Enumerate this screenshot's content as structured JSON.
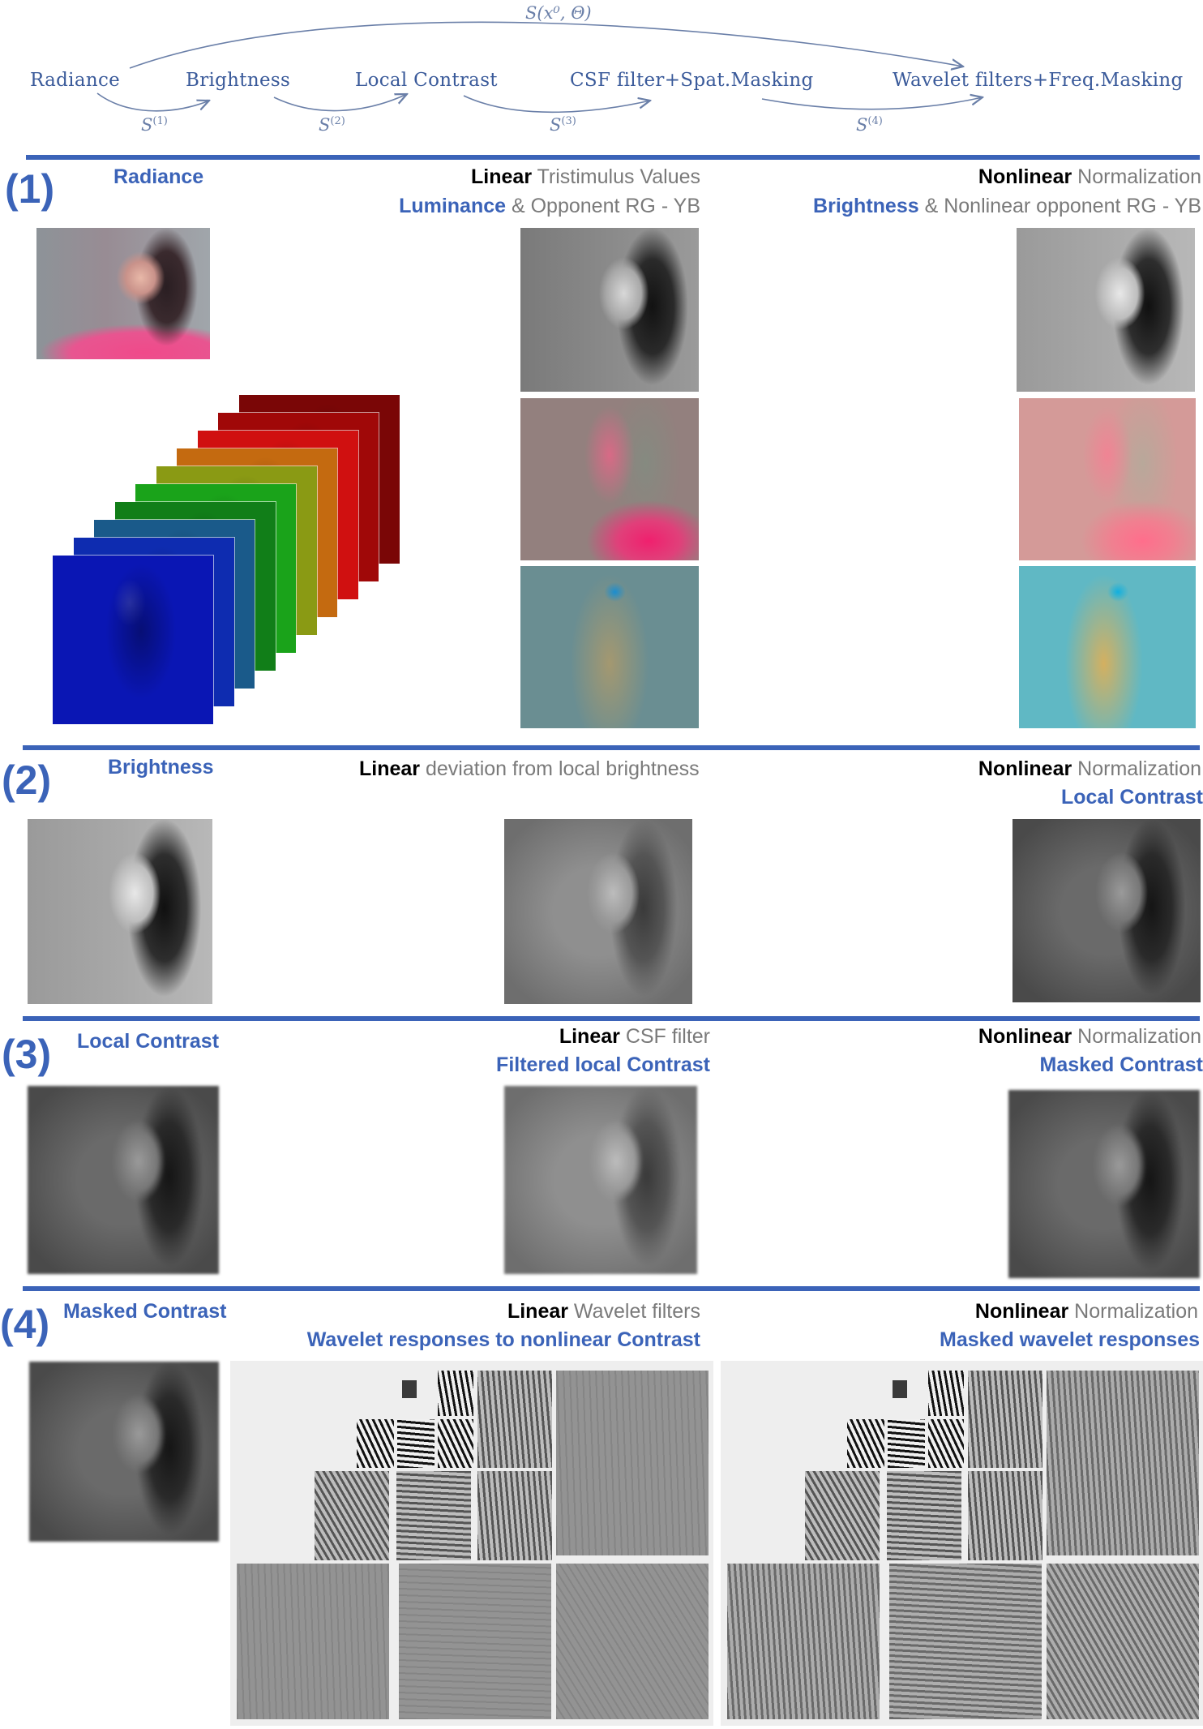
{
  "pipeline": {
    "stages": [
      "Radiance",
      "Brightness",
      "Local Contrast",
      "CSF filter+Spat.Masking",
      "Wavelet filters+Freq.Masking"
    ],
    "operators": [
      "S",
      "S",
      "S",
      "S"
    ],
    "operator_superscripts": [
      "(1)",
      "(2)",
      "(3)",
      "(4)"
    ],
    "global_operator": "S(x⁰, Θ)",
    "colors": {
      "stage_text": "#3a5a9a",
      "operator_text": "#6a7fa8",
      "arrow": "#6a7fa8"
    }
  },
  "accent_color": "#3b63b8",
  "sections": [
    {
      "number": "(1)",
      "input_label": "Radiance",
      "linear": {
        "bold": "Linear",
        "rest": " Tristimulus Values",
        "output_bold": "Luminance",
        "output_rest": " & Opponent RG - YB"
      },
      "nonlinear": {
        "bold": "Nonlinear",
        "rest": " Normalization",
        "output_bold": "Brightness",
        "output_rest": " & Nonlinear opponent RG - YB"
      },
      "images": {
        "input": [
          "color portrait",
          "spectral radiance stack"
        ],
        "linear": [
          "luminance",
          "opponent RG",
          "opponent YB"
        ],
        "nonlinear": [
          "brightness",
          "nonlinear opponent RG",
          "nonlinear opponent YB"
        ]
      },
      "spectral_stack_colors": [
        "#0a16b4",
        "#0e2cb0",
        "#1a5a8a",
        "#117e18",
        "#1aa31a",
        "#8a9a14",
        "#c46a10",
        "#d01010",
        "#a00808",
        "#7a0606"
      ]
    },
    {
      "number": "(2)",
      "input_label": "Brightness",
      "linear": {
        "bold": "Linear",
        "rest": " deviation from local brightness"
      },
      "nonlinear": {
        "bold": "Nonlinear",
        "rest": " Normalization",
        "output_bold": "Local Contrast"
      }
    },
    {
      "number": "(3)",
      "input_label": "Local Contrast",
      "linear": {
        "bold": "Linear",
        "rest": " CSF filter",
        "output_bold": "Filtered local Contrast"
      },
      "nonlinear": {
        "bold": "Nonlinear",
        "rest": " Normalization",
        "output_bold": "Masked Contrast"
      }
    },
    {
      "number": "(4)",
      "input_label": "Masked Contrast",
      "linear": {
        "bold": "Linear",
        "rest": " Wavelet filters",
        "output_bold": "Wavelet responses to nonlinear Contrast"
      },
      "nonlinear": {
        "bold": "Nonlinear",
        "rest": " Normalization",
        "output_bold": "Masked wavelet responses"
      }
    }
  ]
}
